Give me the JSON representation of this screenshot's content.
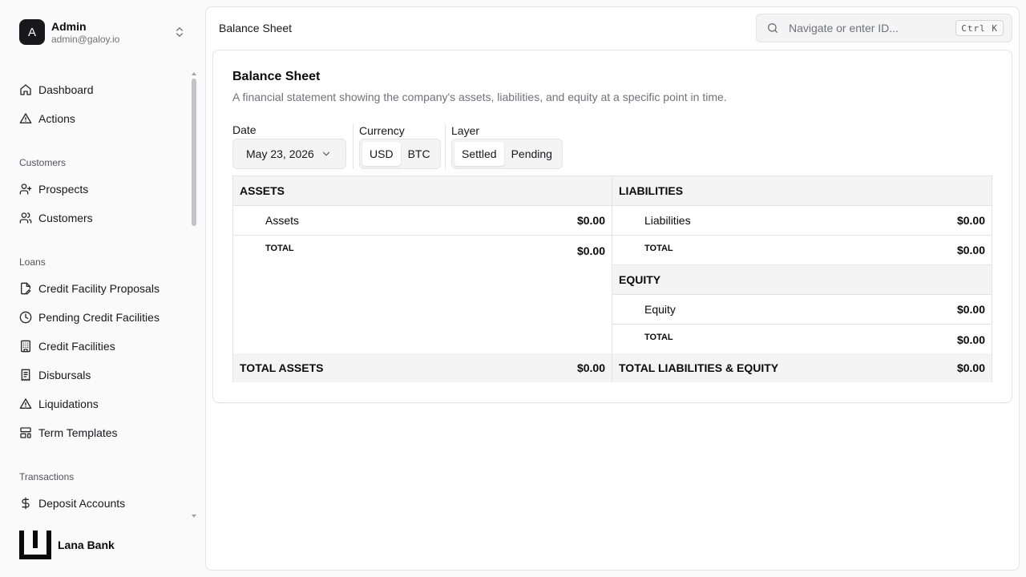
{
  "user": {
    "initial": "A",
    "name": "Admin",
    "email": "admin@galoy.io"
  },
  "nav": {
    "top": [
      {
        "label": "Dashboard",
        "icon": "home-icon"
      },
      {
        "label": "Actions",
        "icon": "alert-triangle-icon"
      }
    ],
    "groups": [
      {
        "title": "Customers",
        "items": [
          {
            "label": "Prospects",
            "icon": "user-plus-icon"
          },
          {
            "label": "Customers",
            "icon": "users-icon"
          }
        ]
      },
      {
        "title": "Loans",
        "items": [
          {
            "label": "Credit Facility Proposals",
            "icon": "file-pen-icon"
          },
          {
            "label": "Pending Credit Facilities",
            "icon": "clock-icon"
          },
          {
            "label": "Credit Facilities",
            "icon": "building-icon"
          },
          {
            "label": "Disbursals",
            "icon": "receipt-icon"
          },
          {
            "label": "Liquidations",
            "icon": "alert-triangle-icon"
          },
          {
            "label": "Term Templates",
            "icon": "layout-template-icon"
          }
        ]
      },
      {
        "title": "Transactions",
        "items": [
          {
            "label": "Deposit Accounts",
            "icon": "dollar-sign-icon"
          }
        ]
      }
    ]
  },
  "brand": {
    "name": "Lana Bank"
  },
  "topbar": {
    "title": "Balance Sheet",
    "search_placeholder": "Navigate or enter ID...",
    "shortcut": "Ctrl K"
  },
  "card": {
    "title": "Balance Sheet",
    "description": "A financial statement showing the company's assets, liabilities, and equity at a specific point in time."
  },
  "filters": {
    "date_label": "Date",
    "date_value": "May 23, 2026",
    "currency_label": "Currency",
    "currency_options": [
      "USD",
      "BTC"
    ],
    "currency_selected": "USD",
    "layer_label": "Layer",
    "layer_options": [
      "Settled",
      "Pending"
    ],
    "layer_selected": "Settled"
  },
  "sheet": {
    "assets": {
      "heading": "ASSETS",
      "item_label": "Assets",
      "item_amount": "$0.00",
      "total_label": "TOTAL",
      "total_amount": "$0.00"
    },
    "liabilities": {
      "heading": "LIABILITIES",
      "item_label": "Liabilities",
      "item_amount": "$0.00",
      "total_label": "TOTAL",
      "total_amount": "$0.00"
    },
    "equity": {
      "heading": "EQUITY",
      "item_label": "Equity",
      "item_amount": "$0.00",
      "total_label": "TOTAL",
      "total_amount": "$0.00"
    },
    "total_assets_label": "TOTAL ASSETS",
    "total_assets_amount": "$0.00",
    "total_le_label": "TOTAL LIABILITIES & EQUITY",
    "total_le_amount": "$0.00"
  }
}
